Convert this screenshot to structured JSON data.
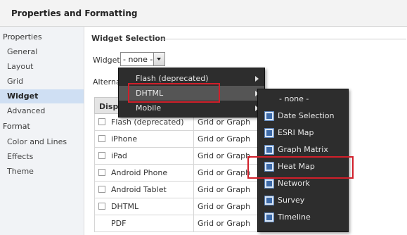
{
  "title": "Properties and Formatting",
  "sidebar": {
    "groups": [
      {
        "label": "Properties",
        "items": [
          "General",
          "Layout",
          "Grid",
          "Widget",
          "Advanced"
        ]
      },
      {
        "label": "Format",
        "items": [
          "Color and Lines",
          "Effects",
          "Theme"
        ]
      }
    ],
    "active_item": "Widget"
  },
  "main": {
    "section_title": "Widget Selection",
    "widget_label": "Widget:",
    "widget_value": "- none -",
    "alternate_label": "Alternat",
    "table": {
      "header": "Displ",
      "rows": [
        {
          "name": "Flash (deprecated)",
          "mode": "Grid or Graph"
        },
        {
          "name": "iPhone",
          "mode": "Grid or Graph"
        },
        {
          "name": "iPad",
          "mode": "Grid or Graph"
        },
        {
          "name": "Android Phone",
          "mode": "Grid or Graph"
        },
        {
          "name": "Android Tablet",
          "mode": "Grid or Graph"
        },
        {
          "name": "DHTML",
          "mode": "Grid or Graph"
        },
        {
          "name": "PDF",
          "mode": "Grid or Graph"
        }
      ]
    }
  },
  "menu_level1": {
    "items": [
      "Flash (deprecated)",
      "DHTML",
      "Mobile"
    ],
    "highlighted": "DHTML"
  },
  "menu_level2": {
    "items": [
      "- none -",
      "Date Selection",
      "ESRI Map",
      "Graph Matrix",
      "Heat Map",
      "Network",
      "Survey",
      "Timeline"
    ],
    "highlighted": "Heat Map"
  },
  "colors": {
    "menu_bg": "#2d2d2d",
    "highlight_box": "#d11f2a",
    "active_sidebar": "#cfdff3"
  }
}
